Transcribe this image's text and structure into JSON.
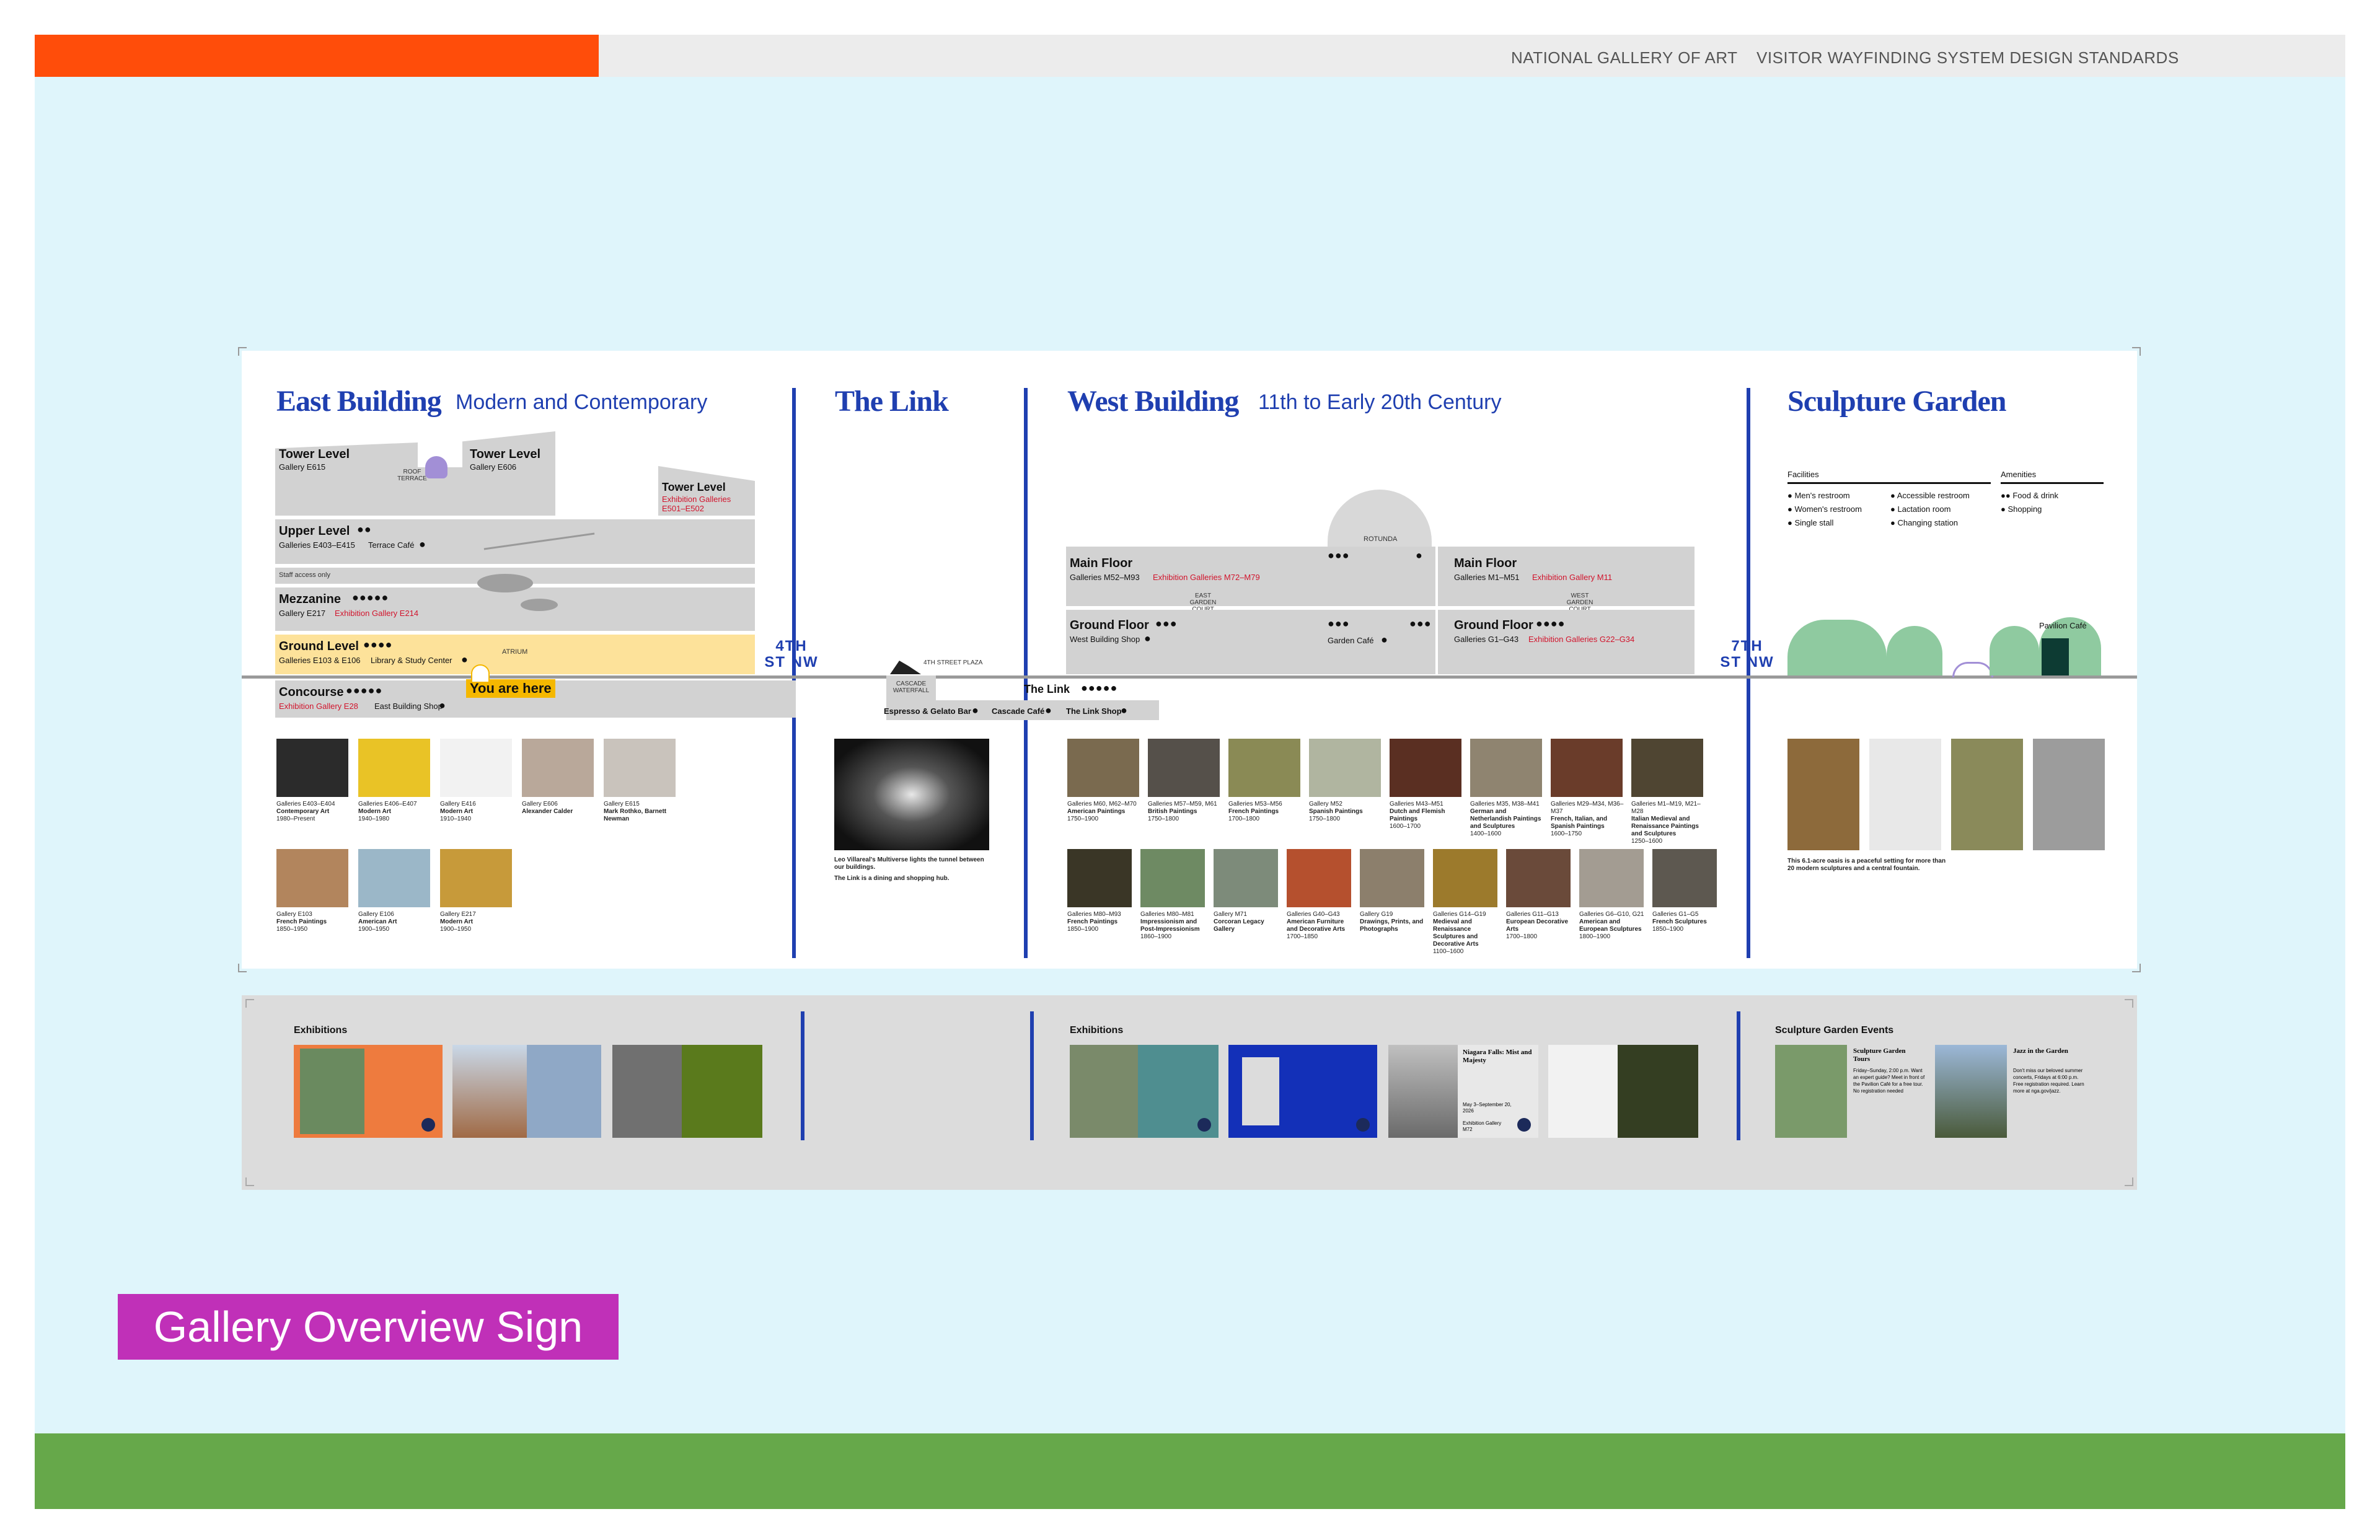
{
  "header": {
    "org": "NATIONAL GALLERY OF ART",
    "doc": "VISITOR WAYFINDING SYSTEM DESIGN STANDARDS"
  },
  "colors": {
    "orange": "#ff4d0a",
    "blue": "#1f3fb0",
    "red": "#d1142c",
    "purple": "#c030b8",
    "green": "#66a84a",
    "canvas": "#dff5fb"
  },
  "sign_label": "Gallery Overview Sign",
  "east": {
    "title": "East Building",
    "subtitle": "Modern and Contemporary",
    "tower1": {
      "title": "Tower Level",
      "sub": "Gallery E615"
    },
    "roof": "ROOF TERRACE",
    "tower2": {
      "title": "Tower Level",
      "sub": "Gallery E606"
    },
    "tower3": {
      "title": "Tower Level",
      "sub": "Exhibition Galleries E501–E502"
    },
    "upper": {
      "title": "Upper Level",
      "sub": "Galleries E403–E415",
      "extra": "Terrace Café"
    },
    "staff": "Staff access only",
    "mezz": {
      "title": "Mezzanine",
      "sub": "Gallery E217",
      "red": "Exhibition Gallery E214"
    },
    "ground": {
      "title": "Ground Level",
      "sub": "Galleries E103 & E106",
      "extra": "Library & Study Center",
      "atrium": "ATRIUM"
    },
    "concourse": {
      "title": "Concourse",
      "red": "Exhibition Gallery E28",
      "extra": "East Building Shop"
    },
    "you_are_here": "You are here",
    "thumbs": [
      {
        "g": "Galleries E403–E404",
        "t": "Contemporary Art",
        "d": "1980–Present",
        "c": "#2b2b2b"
      },
      {
        "g": "Galleries E406–E407",
        "t": "Modern Art",
        "d": "1940–1980",
        "c": "#e9c326"
      },
      {
        "g": "Gallery E416",
        "t": "Modern Art",
        "d": "1910–1940",
        "c": "#f2f2f2"
      },
      {
        "g": "Gallery E606",
        "t": "Alexander Calder",
        "d": "",
        "c": "#b9a89a"
      },
      {
        "g": "Gallery E615",
        "t": "Mark Rothko, Barnett Newman",
        "d": "",
        "c": "#c9c3bc"
      },
      {
        "g": "Gallery E103",
        "t": "French Paintings",
        "d": "1850–1950",
        "c": "#b2855d"
      },
      {
        "g": "Gallery E106",
        "t": "American Art",
        "d": "1900–1950",
        "c": "#9bb7c8"
      },
      {
        "g": "Gallery E217",
        "t": "Modern Art",
        "d": "1900–1950",
        "c": "#c79a3a"
      }
    ]
  },
  "link": {
    "title": "The Link",
    "plaza": "4TH STREET PLAZA",
    "waterfall": "CASCADE WATERFALL",
    "espresso": "Espresso & Gelato Bar",
    "cascade": "Cascade Café",
    "label": "The Link",
    "shop": "The Link Shop",
    "caption1": "Leo Villareal's Multiverse lights the tunnel between our buildings.",
    "caption2": "The Link is a dining and shopping hub."
  },
  "streets": {
    "fourth": "4TH ST NW",
    "seventh": "7TH ST NW"
  },
  "west": {
    "title": "West Building",
    "subtitle": "11th to Early 20th Century",
    "rotunda": "ROTUNDA",
    "main_left": {
      "title": "Main Floor",
      "sub": "Galleries M52–M93",
      "red": "Exhibition Galleries M72–M79"
    },
    "main_right": {
      "title": "Main Floor",
      "sub": "Galleries M1–M51",
      "red": "Exhibition Gallery M11"
    },
    "east_court": "EAST GARDEN COURT",
    "west_court": "WEST GARDEN COURT",
    "ground_left": {
      "title": "Ground Floor",
      "sub": "West Building Shop"
    },
    "garden_cafe": "Garden Café",
    "ground_right": {
      "title": "Ground Floor",
      "sub": "Galleries G1–G43",
      "red": "Exhibition Galleries G22–G34"
    },
    "thumbs_row1": [
      {
        "g": "Galleries M60, M62–M70",
        "t": "American Paintings",
        "d": "1750–1900",
        "c": "#7a6a4f"
      },
      {
        "g": "Galleries M57–M59, M61",
        "t": "British Paintings",
        "d": "1750–1800",
        "c": "#55504a"
      },
      {
        "g": "Galleries M53–M56",
        "t": "French Paintings",
        "d": "1700–1800",
        "c": "#8a8a55"
      },
      {
        "g": "Gallery M52",
        "t": "Spanish Paintings",
        "d": "1750–1800",
        "c": "#b0b5a0"
      },
      {
        "g": "Galleries M43–M51",
        "t": "Dutch and Flemish Paintings",
        "d": "1600–1700",
        "c": "#5a2f22"
      },
      {
        "g": "Galleries M35, M38–M41",
        "t": "German and Netherlandish Paintings and Sculptures",
        "d": "1400–1600",
        "c": "#8f8470"
      },
      {
        "g": "Galleries M29–M34, M36–M37",
        "t": "French, Italian, and Spanish Paintings",
        "d": "1600–1750",
        "c": "#6a3c2a"
      },
      {
        "g": "Galleries M1–M19, M21–M28",
        "t": "Italian Medieval and Renaissance Paintings and Sculptures",
        "d": "1250–1600",
        "c": "#4f4532"
      }
    ],
    "thumbs_row2": [
      {
        "g": "Galleries M80–M93",
        "t": "French Paintings",
        "d": "1850–1900",
        "c": "#3a3626"
      },
      {
        "g": "Galleries M80–M81",
        "t": "Impressionism and Post-Impressionism",
        "d": "1860–1900",
        "c": "#6e8a63"
      },
      {
        "g": "Gallery M71",
        "t": "Corcoran Legacy Gallery",
        "d": "",
        "c": "#7d8b7a"
      },
      {
        "g": "Galleries G40–G43",
        "t": "American Furniture and Decorative Arts",
        "d": "1700–1850",
        "c": "#b5502e"
      },
      {
        "g": "Gallery G19",
        "t": "Drawings, Prints, and Photographs",
        "d": "",
        "c": "#8c7f6c"
      },
      {
        "g": "Galleries G14–G19",
        "t": "Medieval and Renaissance Sculptures and Decorative Arts",
        "d": "1100–1600",
        "c": "#9c7a2c"
      },
      {
        "g": "Galleries G11–G13",
        "t": "European Decorative Arts",
        "d": "1700–1800",
        "c": "#6a4a3a"
      },
      {
        "g": "Galleries G6–G10, G21",
        "t": "American and European Sculptures",
        "d": "1800–1900",
        "c": "#a39c92"
      },
      {
        "g": "Galleries G1–G5",
        "t": "French Sculptures",
        "d": "1850–1900",
        "c": "#5d5850"
      }
    ]
  },
  "garden": {
    "title": "Sculpture Garden",
    "facilities_title": "Facilities",
    "amenities_title": "Amenities",
    "facilities": [
      "Men's restroom",
      "Women's restroom",
      "Single stall",
      "Accessible restroom",
      "Lactation room",
      "Changing station"
    ],
    "amenities": [
      "Food & drink",
      "Shopping"
    ],
    "pavilion": "Pavilion Café",
    "caption": "This 6.1-acre oasis is a peaceful setting for more than 20 modern sculptures and a central fountain.",
    "thumbs": [
      {
        "c": "#8d6a3b"
      },
      {
        "c": "#e8e8e8"
      },
      {
        "c": "#8a8a5a"
      },
      {
        "c": "#9c9c9c"
      }
    ]
  },
  "exhibitions": {
    "east_title": "Exhibitions",
    "west_title": "Exhibitions",
    "niagara_title": "Niagara Falls: Mist and Majesty",
    "niagara_dates": "May 3–September 20, 2026",
    "niagara_gallery": "Exhibition Gallery M72",
    "garden_title": "Sculpture Garden Events",
    "tours_title": "Sculpture Garden Tours",
    "tours_text": "Friday–Sunday, 2:00 p.m. Want an expert guide? Meet in front of the Pavilion Café for a free tour. No registration needed",
    "jazz_title": "Jazz in the Garden",
    "jazz_text": "Don't miss our beloved summer concerts, Fridays at 6:00 p.m. Free registration required. Learn more at nga.gov/jazz."
  }
}
